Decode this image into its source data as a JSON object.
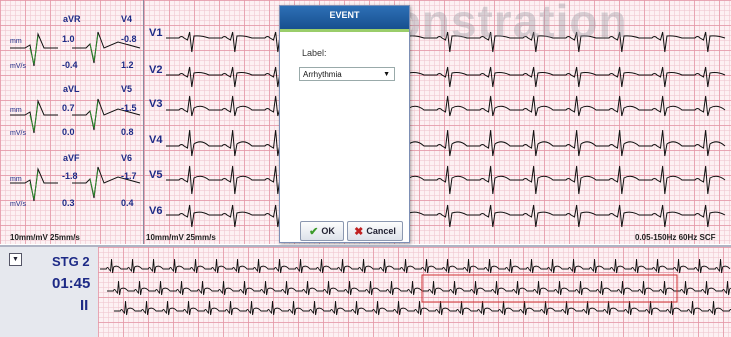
{
  "watermark": "Demonstration",
  "left_panel": {
    "rows": [
      {
        "left_lead": "aVR",
        "left_value": "1.0",
        "left_value2": "-0.4",
        "right_lead": "V4",
        "right_value": "-0.8",
        "right_value2": "1.2"
      },
      {
        "left_lead": "aVL",
        "left_value": "0.7",
        "left_value2": "0.0",
        "right_lead": "V5",
        "right_value": "-1.5",
        "right_value2": "0.8"
      },
      {
        "left_lead": "aVF",
        "left_value": "-1.8",
        "left_value2": "0.3",
        "right_lead": "V6",
        "right_value": "-1.7",
        "right_value2": "0.4"
      }
    ],
    "unit_mm": "mm",
    "unit_mvs": "mV/s",
    "scale": "10mm/mV  25mm/s"
  },
  "main_panel": {
    "leads": [
      "V1",
      "V2",
      "V3",
      "V4",
      "V5",
      "V6"
    ],
    "scale": "10mm/mV  25mm/s",
    "filter": "0.05-150Hz  60Hz  SCF"
  },
  "dialog": {
    "title": "EVENT",
    "label_text": "Label:",
    "selected_label": "Arrhythmia",
    "ok_label": "OK",
    "cancel_label": "Cancel"
  },
  "rhythm": {
    "stage": "STG 2",
    "time": "01:45",
    "lead": "II"
  },
  "colors": {
    "trace": "#111111",
    "trace_highlight": "#2e8b2e",
    "lead_label": "#1d2a86",
    "selection_box": "#d03030",
    "dialog_title": "#1f5fa4"
  }
}
